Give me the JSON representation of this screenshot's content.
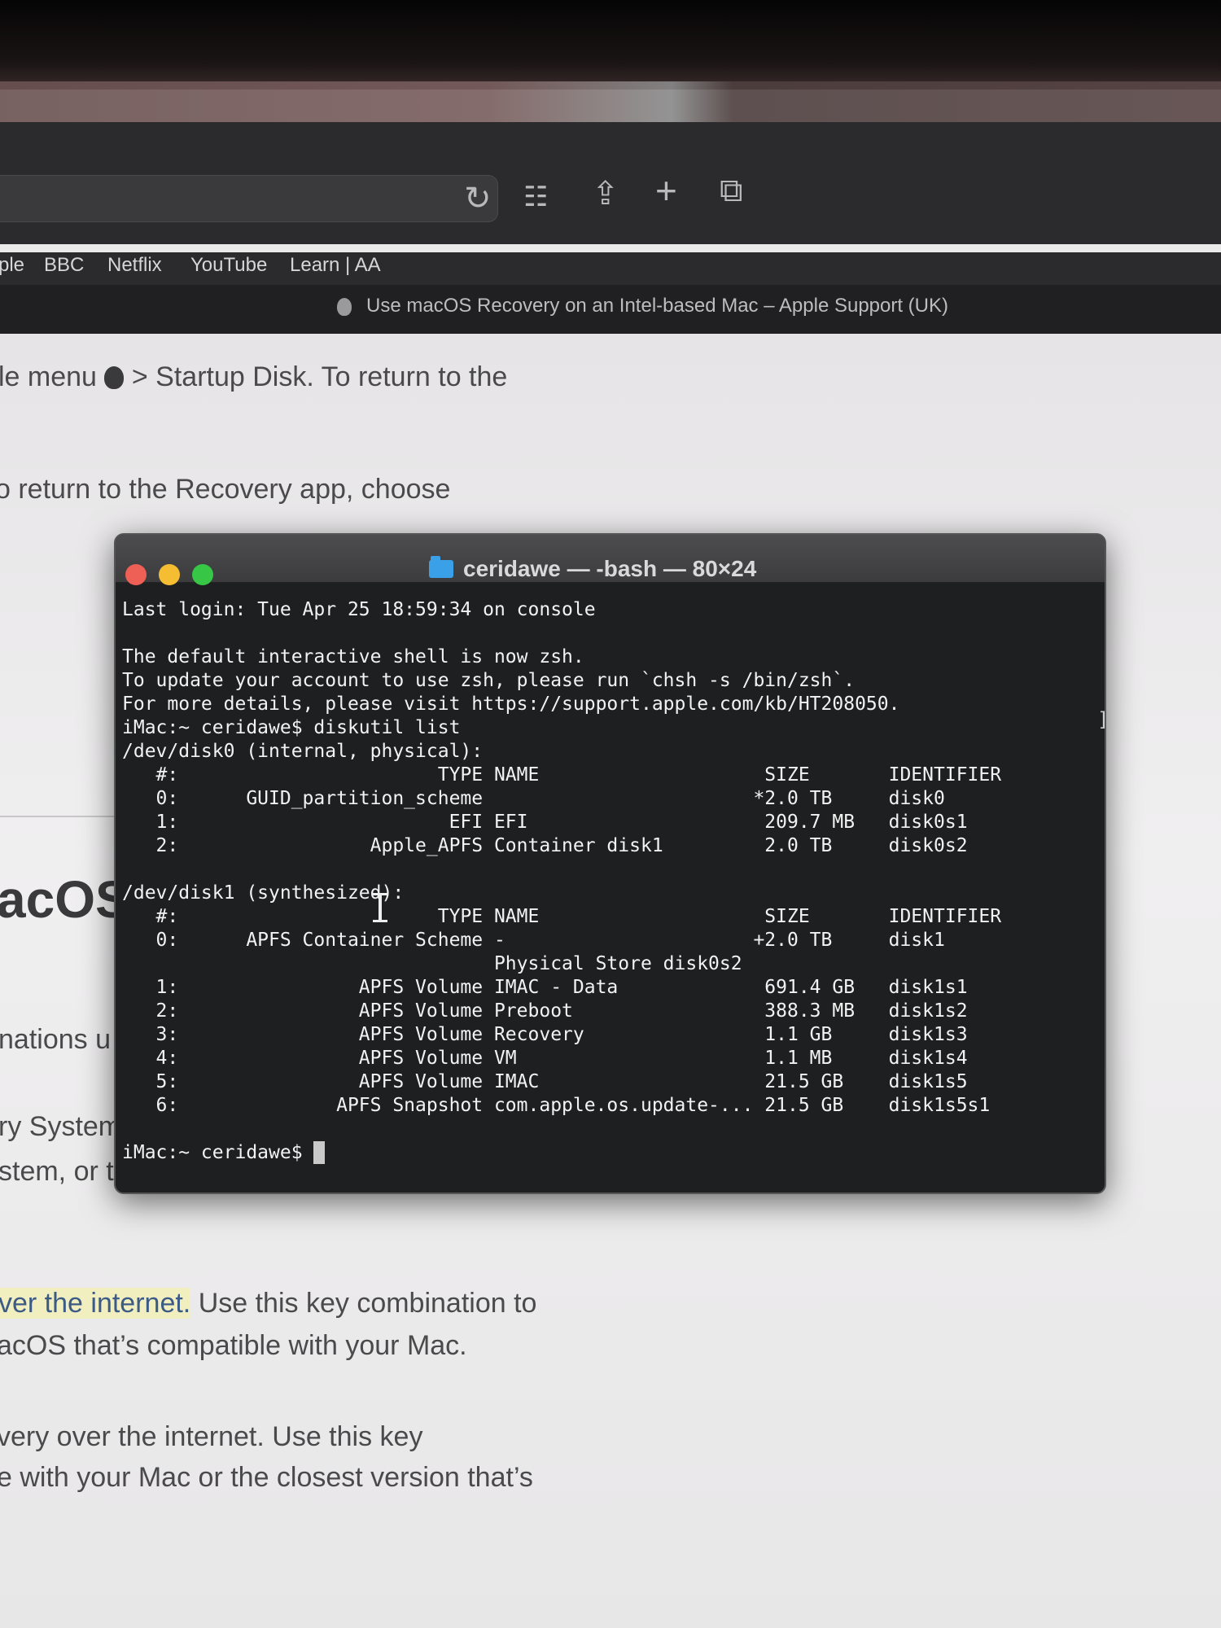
{
  "browser": {
    "toolbar_icons": [
      "reload-icon",
      "grid-icon",
      "share-icon",
      "plus-icon",
      "tabs-icon"
    ],
    "bookmarks": [
      "ple",
      "BBC",
      "Netflix",
      "YouTube",
      "Learn | AA"
    ],
    "tab_title": "Use macOS Recovery on an Intel-based Mac – Apple Support (UK)"
  },
  "page": {
    "line1_a": "le menu",
    "line1_b": "> Startup Disk. To return to the",
    "line2": "o return to the Recovery app, choose",
    "heading": "acOS",
    "line3": "nations u",
    "line4": "ry System",
    "line5": "stem, or to use the other apps in macOS",
    "line6_link": "ver the internet.",
    "line6_rest": " Use this key combination to",
    "line7": "acOS that’s compatible with your Mac.",
    "line8": "very over the internet. Use this key",
    "line9": "e with your Mac or the closest version that’s"
  },
  "terminal": {
    "title": "ceridawe — -bash — 80×24",
    "lines": [
      "Last login: Tue Apr 25 18:59:34 on console",
      "",
      "The default interactive shell is now zsh.",
      "To update your account to use zsh, please run `chsh -s /bin/zsh`.",
      "For more details, please visit https://support.apple.com/kb/HT208050.",
      "iMac:~ ceridawe$ diskutil list",
      "/dev/disk0 (internal, physical):",
      "   #:                       TYPE NAME                    SIZE       IDENTIFIER",
      "   0:      GUID_partition_scheme                        *2.0 TB     disk0",
      "   1:                        EFI EFI                     209.7 MB   disk0s1",
      "   2:                 Apple_APFS Container disk1         2.0 TB     disk0s2",
      "",
      "/dev/disk1 (synthesized):",
      "   #:                       TYPE NAME                    SIZE       IDENTIFIER",
      "   0:      APFS Container Scheme -                      +2.0 TB     disk1",
      "                                 Physical Store disk0s2",
      "   1:                APFS Volume IMAC - Data             691.4 GB   disk1s1",
      "   2:                APFS Volume Preboot                 388.3 MB   disk1s2",
      "   3:                APFS Volume Recovery                1.1 GB     disk1s3",
      "   4:                APFS Volume VM                      1.1 MB     disk1s4",
      "   5:                APFS Volume IMAC                    21.5 GB    disk1s5",
      "   6:              APFS Snapshot com.apple.os.update-... 21.5 GB    disk1s5s1",
      ""
    ],
    "prompt": "iMac:~ ceridawe$ "
  }
}
